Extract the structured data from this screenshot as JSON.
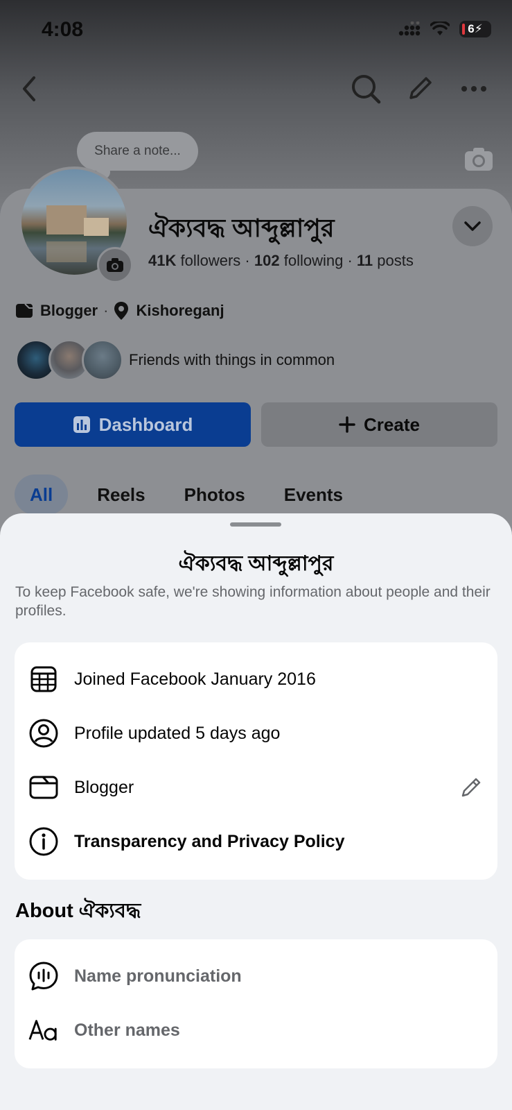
{
  "status_bar": {
    "time": "4:08",
    "battery": "6"
  },
  "profile": {
    "note_placeholder": "Share a note...",
    "name": "ঐক্যবদ্ধ আব্দুল্লাপুর",
    "followers_count": "41K",
    "followers_label": "followers",
    "following_count": "102",
    "following_label": "following",
    "posts_count": "11",
    "posts_label": "posts",
    "category": "Blogger",
    "separator": "·",
    "location": "Kishoreganj",
    "friends_text": "Friends with things in common"
  },
  "buttons": {
    "dashboard": "Dashboard",
    "create": "Create"
  },
  "tabs": [
    "All",
    "Reels",
    "Photos",
    "Events"
  ],
  "sheet": {
    "title": "ঐক্যবদ্ধ আব্দুল্লাপুর",
    "description": "To keep Facebook safe, we're showing information about people and their profiles.",
    "info_rows": [
      {
        "icon": "calendar-icon",
        "label": "Joined Facebook January 2016"
      },
      {
        "icon": "profile-icon",
        "label": "Profile updated 5 days ago"
      },
      {
        "icon": "clapper-icon",
        "label": "Blogger"
      },
      {
        "icon": "info-icon",
        "label": "Transparency and Privacy Policy"
      }
    ],
    "about_title": "About ঐক্যবদ্ধ",
    "about_rows": [
      {
        "icon": "speech-wave-icon",
        "label": "Name pronunciation"
      },
      {
        "icon": "text-aa-icon",
        "label": "Other names"
      }
    ]
  },
  "colors": {
    "brand_blue": "#0a3d91",
    "sheet_bg": "#f0f2f5",
    "muted_text": "#65676b"
  }
}
